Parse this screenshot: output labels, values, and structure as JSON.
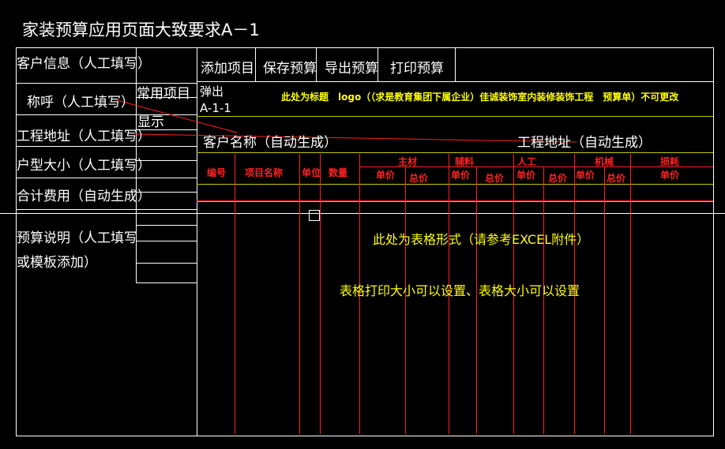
{
  "title": "家装预算应用页面大致要求A－1",
  "left_panel": {
    "customer_info": "客户信息（人工填写）",
    "salutation": "称呼（人工填写）",
    "address": "工程地址（人工填写）",
    "house_type": "户型大小（人工填写）",
    "total_cost": "合计费用（自动生成）",
    "budget_note_line1": "预算说明（人工填写",
    "budget_note_line2": "或模板添加）"
  },
  "common_items": {
    "header": "常用项目",
    "display": "显示"
  },
  "toolbar": {
    "add_item": "添加项目",
    "save_budget": "保存预算",
    "export_budget": "导出预算",
    "print_budget": "打印预算"
  },
  "popup": {
    "line1": "弹出",
    "line2": "A-1-1"
  },
  "title_bar_text": "此处为标题　logo（（求是教育集团下属企业）佳诚装饰室内装修装饰工程　预算单）不可更改",
  "customer_name": "客户名称（自动生成）",
  "project_address": "工程地址（自动生成）",
  "table": {
    "columns": [
      "编号",
      "项目名称",
      "单位",
      "数量"
    ],
    "groups": [
      {
        "name": "主材",
        "sub": [
          "单价",
          "总价"
        ]
      },
      {
        "name": "辅料",
        "sub": [
          "单价",
          "总价"
        ]
      },
      {
        "name": "人工",
        "sub": [
          "单价",
          "总价"
        ]
      },
      {
        "name": "机械",
        "sub": [
          "单价",
          "总价"
        ]
      },
      {
        "name": "损耗",
        "sub": [
          "单价"
        ]
      }
    ]
  },
  "notes": {
    "table_form": "此处为表格形式（请参考EXCEL附件）",
    "print_size": "表格打印大小可以设置、表格大小可以设置"
  },
  "colors": {
    "background": "#000000",
    "line_white": "#ffffff",
    "text_yellow": "#ffff00",
    "text_red": "#ff2020"
  }
}
